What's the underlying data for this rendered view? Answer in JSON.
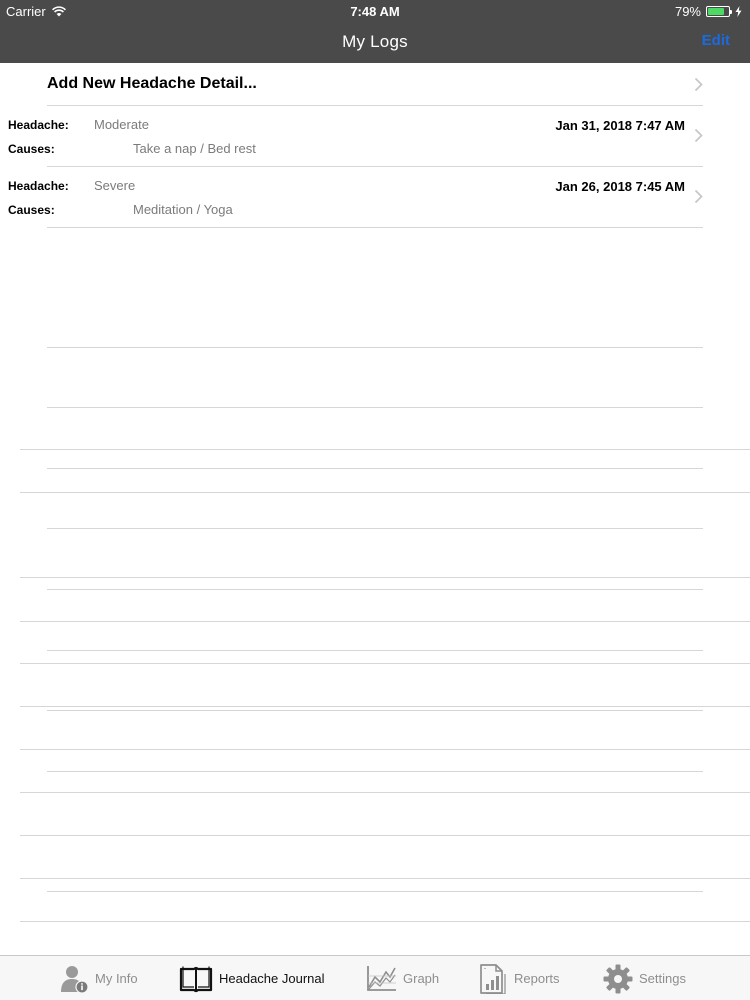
{
  "status_bar": {
    "carrier": "Carrier",
    "time": "7:48 AM",
    "battery_percent": "79%",
    "battery_level": 0.79,
    "battery_color": "#4cd964"
  },
  "nav": {
    "title": "My Logs",
    "edit_label": "Edit",
    "background_color": "#4a4a4a",
    "accent_color": "#1b6be0"
  },
  "add_row": {
    "label": "Add New Headache Detail..."
  },
  "labels": {
    "headache": "Headache:",
    "causes": "Causes:"
  },
  "logs": [
    {
      "severity": "Moderate",
      "date": "Jan 31, 2018 7:47 AM",
      "causes": "Take a nap / Bed rest"
    },
    {
      "severity": "Severe",
      "date": "Jan 26, 2018 7:45 AM",
      "causes": "Meditation / Yoga"
    }
  ],
  "tabs": [
    {
      "label": "My Info",
      "icon": "user-info-icon",
      "active": false
    },
    {
      "label": "Headache Journal",
      "icon": "open-book-icon",
      "active": true
    },
    {
      "label": "Graph",
      "icon": "line-graph-icon",
      "active": false
    },
    {
      "label": "Reports",
      "icon": "report-document-icon",
      "active": false
    },
    {
      "label": "Settings",
      "icon": "gear-icon",
      "active": false
    }
  ]
}
